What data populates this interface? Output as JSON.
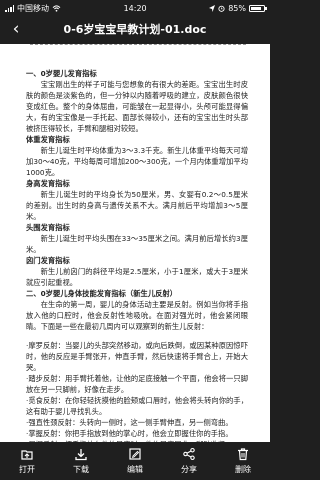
{
  "status": {
    "carrier": "中国移动",
    "time": "14:20",
    "battery": "85%"
  },
  "header": {
    "title": "0-6岁宝宝早教计划-01.doc"
  },
  "doc": [
    {
      "t": "一、0岁婴儿发育指标",
      "cls": "h"
    },
    {
      "t": "宝宝刚出生的样子可能与您想象的有很大的差距。宝宝出生时皮肤的颜色是淡紫色的，但一分钟以内随着呼吸的建立，皮肤颜色很快变成红色。整个的身体屈曲，可能皱在一起显得小，头颅可能显得偏大，有的宝宝像是一手托起、面部长得较小，还有的宝宝出生时头部被挤压得较长，手臂和腿相对较短。",
      "cls": "ind"
    },
    {
      "t": "体重发育指标",
      "cls": "h"
    },
    {
      "t": "新生儿诞生时平均体重为3～3.3千克。新生儿体重平均每天可增加30～40克，平均每周可增加200～300克，一个月内体重增加平均1000克。",
      "cls": "ind"
    },
    {
      "t": "身高发育指标",
      "cls": "h"
    },
    {
      "t": "新生儿诞生时的平均身长为50厘米，男、女婴有0.2～0.5厘米的差别。出生时的身高与遗传关系不大。满月前后平均增加3～5厘米。",
      "cls": "ind"
    },
    {
      "t": "头围发育指标",
      "cls": "h"
    },
    {
      "t": "新生儿诞生时平均头围在33～35厘米之间。满月前后增长约3厘米。",
      "cls": "ind"
    },
    {
      "t": "囟门发育指标",
      "cls": "h"
    },
    {
      "t": "新生儿前囟门的斜径平均是2.5厘米，小于1厘米，或大于3厘米就应引起重视。",
      "cls": "ind"
    },
    {
      "t": "二、0岁婴儿身体技能发育指标（新生儿反射）",
      "cls": "h"
    },
    {
      "t": "在生命的第一周，婴儿的身体活动主要是反射。例如当你将手指放入他的口腔时，他会反射性地吸吮。在面对强光时，他会紧闭眼睛。下面是一些在最初几周内可以观察到的新生儿反射：",
      "cls": "ind"
    },
    {
      "t": "",
      "cls": "gap"
    },
    {
      "t": "·摩罗反射：当婴儿的头部突然移动，或向后跌倒，或因某种原因惊吓时，他的反应是手臂张开，伸直手臂，然后快速将手臂合上，开始大哭。",
      "cls": ""
    },
    {
      "t": "·踏步反射：用手臂托着他，让他的足底接触一个平面，他会将一只脚放在另一只脚前，好像在走步。",
      "cls": ""
    },
    {
      "t": "·觅食反射：在你轻轻抚摸他的脸颊或口唇时，他会将头转向你的手，这有助于婴儿寻找乳头。",
      "cls": ""
    },
    {
      "t": "·强直性颈反射：头转向一侧时，这一侧手臂伸直，另一侧弯曲。",
      "cls": ""
    },
    {
      "t": "·掌握反射：你把手指放到他的掌心时，他会立即握住你的手指。",
      "cls": ""
    },
    {
      "t": "·足握反射：把手指放在他的足底时，他的足底屈曲，脚趾收紧。",
      "cls": ""
    }
  ],
  "toolbar": [
    {
      "label": "打开",
      "icon": "open-icon"
    },
    {
      "label": "下载",
      "icon": "download-icon"
    },
    {
      "label": "编辑",
      "icon": "edit-icon"
    },
    {
      "label": "分享",
      "icon": "share-icon"
    },
    {
      "label": "删除",
      "icon": "delete-icon"
    }
  ]
}
